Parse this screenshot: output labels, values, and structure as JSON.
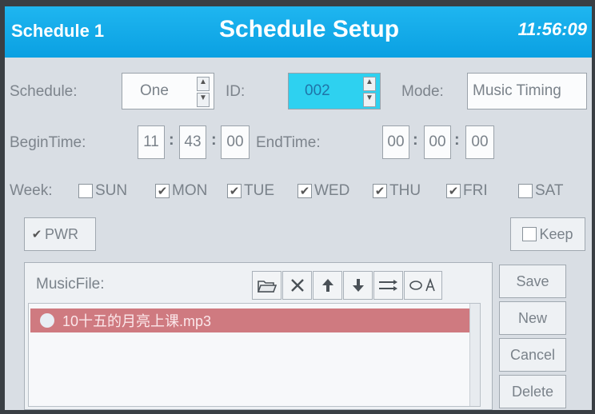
{
  "titlebar": {
    "left": "Schedule 1",
    "center": "Schedule Setup",
    "time": "11:56:09"
  },
  "row1": {
    "schedule_label": "Schedule:",
    "schedule_value": "One",
    "id_label": "ID:",
    "id_value": "002",
    "mode_label": "Mode:",
    "mode_value": "Music Timing"
  },
  "row2": {
    "begin_label": "BeginTime:",
    "begin": [
      "11",
      "43",
      "00"
    ],
    "end_label": "EndTime:",
    "end": [
      "00",
      "00",
      "00"
    ],
    "sep": ":"
  },
  "week": {
    "label": "Week:",
    "days": [
      {
        "label": "SUN",
        "checked": false
      },
      {
        "label": "MON",
        "checked": true
      },
      {
        "label": "TUE",
        "checked": true
      },
      {
        "label": "WED",
        "checked": true
      },
      {
        "label": "THU",
        "checked": true
      },
      {
        "label": "FRI",
        "checked": true
      },
      {
        "label": "SAT",
        "checked": false
      }
    ]
  },
  "pwr": {
    "label": "PWR",
    "checked": true
  },
  "keep": {
    "label": "Keep",
    "checked": false
  },
  "music": {
    "label": "MusicFile:",
    "files": [
      {
        "name": "10十五的月亮上课.mp3",
        "selected": true
      }
    ]
  },
  "toolbar_icons": [
    "open-folder-icon",
    "delete-x-icon",
    "move-up-icon",
    "move-down-icon",
    "sequential-play-icon",
    "repeat-play-icon"
  ],
  "side_buttons": {
    "save": "Save",
    "new": "New",
    "cancel": "Cancel",
    "delete": "Delete"
  },
  "check_glyph": "✔",
  "colors": {
    "titlebar": "#0aa0e2",
    "highlight_field": "#2ed1f0",
    "selected_row": "#cf7a80",
    "row_marker": "#d51f2b"
  }
}
